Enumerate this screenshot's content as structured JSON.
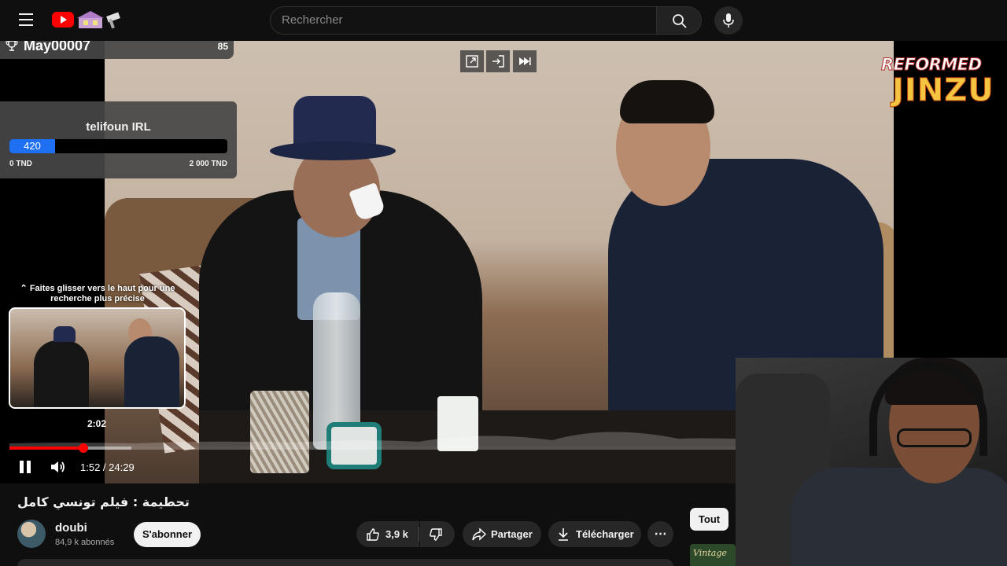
{
  "header": {
    "search_placeholder": "Rechercher"
  },
  "player": {
    "overlay": {
      "user_name": "May00007",
      "user_count": "85"
    },
    "goal": {
      "title": "telifoun IRL",
      "value": "420",
      "min_label": "0 TND",
      "max_label": "2 000 TND",
      "progress_fraction": 0.21
    },
    "preview": {
      "hint": "Faites glisser vers le haut pour une recherche plus précise",
      "time": "2:02"
    },
    "progress": {
      "current_fraction": 0.076,
      "buffered_fraction": 0.125
    },
    "time_display": "1:52 / 24:29",
    "logo_top": "REFORMED",
    "logo_bottom": "JINZU",
    "accent_color": "#ff0000"
  },
  "video": {
    "title": "تحطيمة : فيلم تونسي كامل",
    "channel": "doubi",
    "subscribers": "84,9 k abonnés",
    "subscribe_label": "S'abonner",
    "likes": "3,9 k",
    "share_label": "Partager",
    "download_label": "Télécharger"
  },
  "sidebar": {
    "chip_all": "Tout",
    "rec_thumb_text": "Vintage"
  }
}
